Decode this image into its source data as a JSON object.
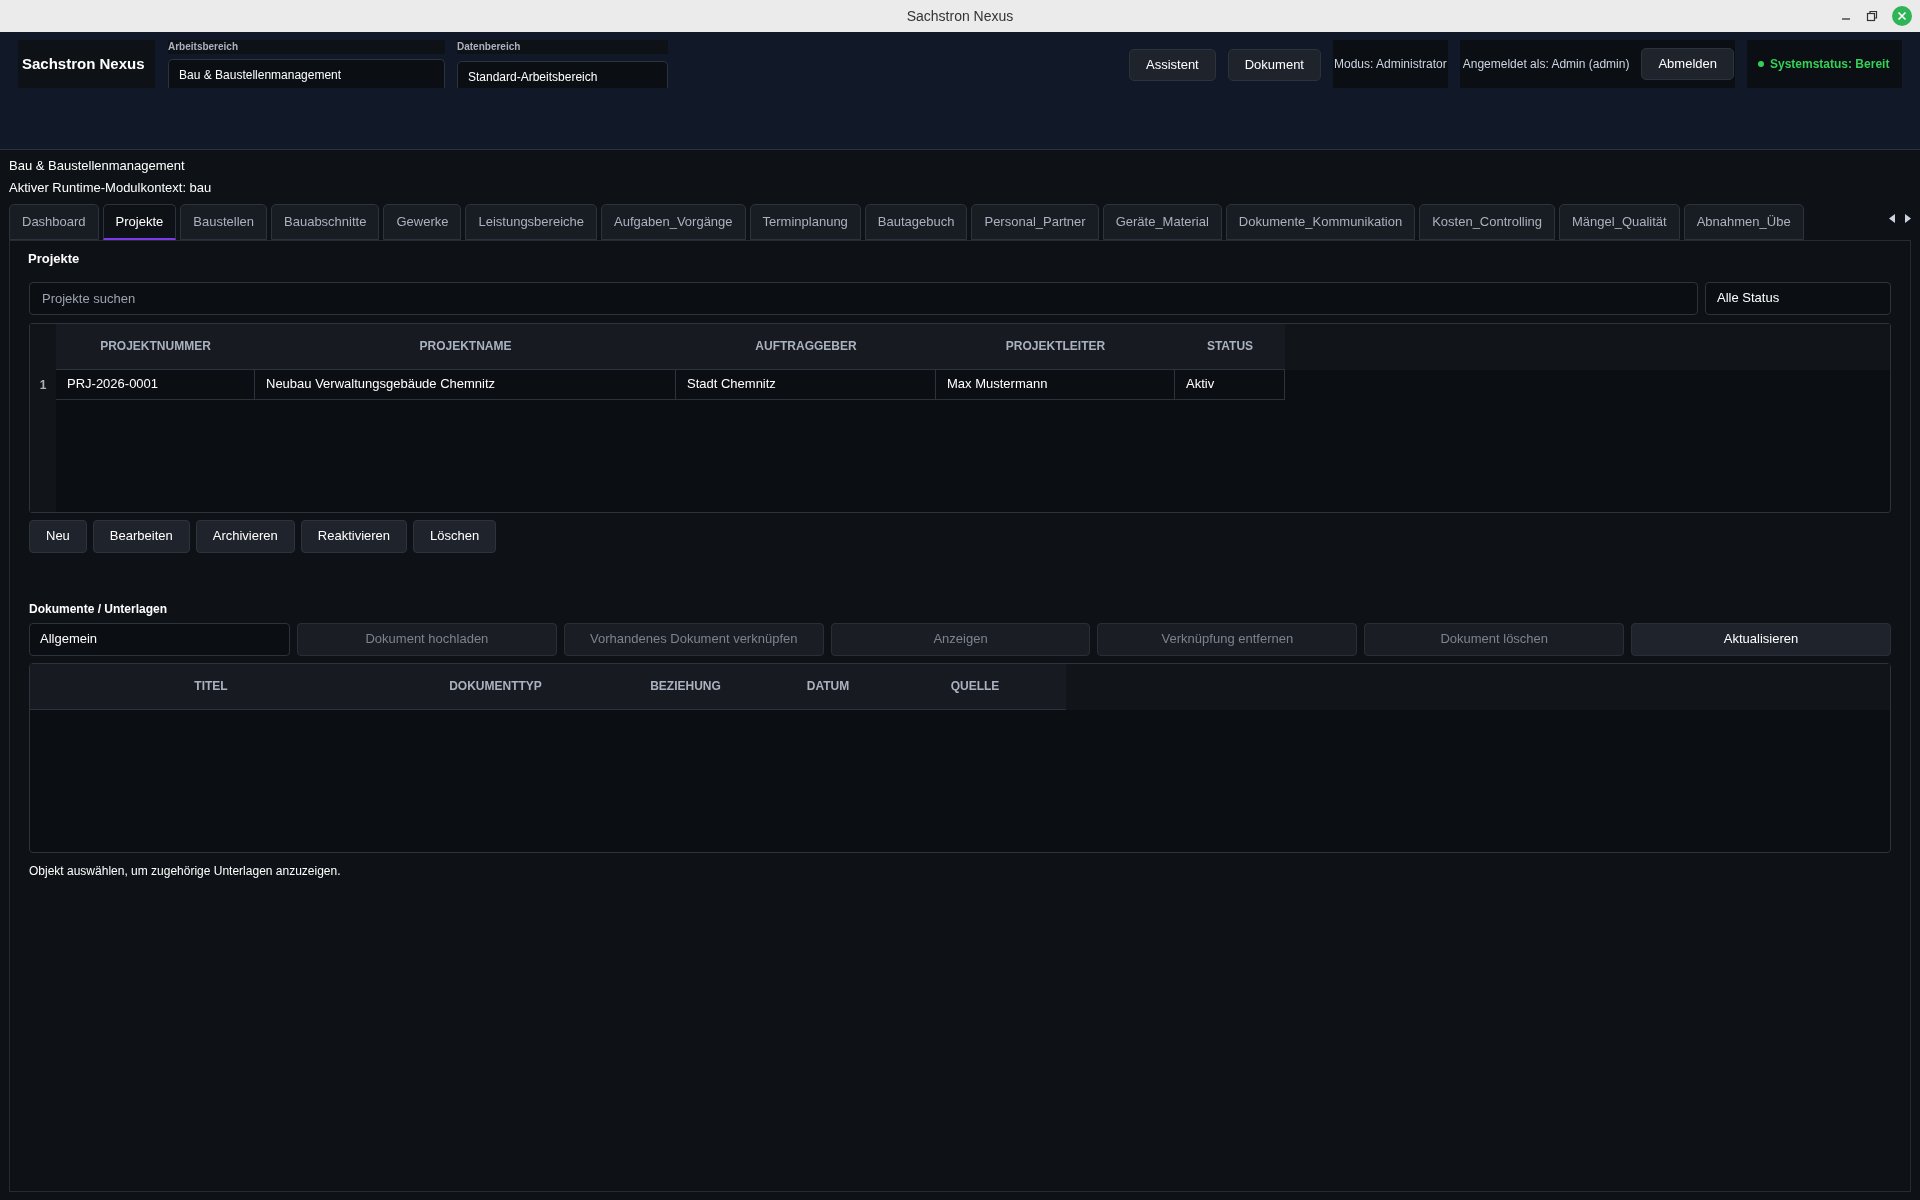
{
  "window": {
    "title": "Sachstron Nexus"
  },
  "header": {
    "brand": "Sachstron Nexus",
    "selectors": [
      {
        "label": "Arbeitsbereich",
        "value": "Bau & Baustellenmanagement"
      },
      {
        "label": "Datenbereich",
        "value": "Standard-Arbeitsbereich"
      }
    ],
    "buttons": [
      "Assistent",
      "Dokument"
    ],
    "mode": "Modus: Administrator",
    "user": "Angemeldet als: Admin (admin)",
    "logout": "Abmelden",
    "status": "Systemstatus: Bereit"
  },
  "context": [
    "Bau & Baustellenmanagement",
    "Aktiver Runtime-Modulkontext: bau"
  ],
  "tabs": [
    {
      "label": "Dashboard",
      "selected": false
    },
    {
      "label": "Projekte",
      "selected": true
    },
    {
      "label": "Baustellen",
      "selected": false
    },
    {
      "label": "Bauabschnitte",
      "selected": false
    },
    {
      "label": "Gewerke",
      "selected": false
    },
    {
      "label": "Leistungsbereiche",
      "selected": false
    },
    {
      "label": "Aufgaben_Vorgänge",
      "selected": false
    },
    {
      "label": "Terminplanung",
      "selected": false
    },
    {
      "label": "Bautagebuch",
      "selected": false
    },
    {
      "label": "Personal_Partner",
      "selected": false
    },
    {
      "label": "Geräte_Material",
      "selected": false
    },
    {
      "label": "Dokumente_Kommunikation",
      "selected": false
    },
    {
      "label": "Kosten_Controlling",
      "selected": false
    },
    {
      "label": "Mängel_Qualität",
      "selected": false
    },
    {
      "label": "Abnahmen_Übe",
      "selected": false
    }
  ],
  "projects": {
    "title": "Projekte",
    "search": {
      "placeholder": "Projekte suchen"
    },
    "status_filter": "Alle Status",
    "columns": [
      "PROJEKTNUMMER",
      "PROJEKTNAME",
      "AUFTRAGGEBER",
      "PROJEKTLEITER",
      "STATUS"
    ],
    "rows": [
      {
        "number": "1",
        "cells": [
          "PRJ-2026-0001",
          "Neubau Verwaltungsgebäude Chemnitz",
          "Stadt Chemnitz",
          "Max Mustermann",
          "Aktiv"
        ]
      }
    ],
    "buttons": [
      "Neu",
      "Bearbeiten",
      "Archivieren",
      "Reaktivieren",
      "Löschen"
    ]
  },
  "documents": {
    "title": "Dokumente / Unterlagen",
    "category": "Allgemein",
    "buttons": [
      {
        "label": "Dokument hochladen",
        "disabled": true
      },
      {
        "label": "Vorhandenes Dokument verknüpfen",
        "disabled": true
      },
      {
        "label": "Anzeigen",
        "disabled": true
      },
      {
        "label": "Verknüpfung entfernen",
        "disabled": true
      },
      {
        "label": "Dokument löschen",
        "disabled": true
      },
      {
        "label": "Aktualisieren",
        "disabled": false
      }
    ],
    "columns": [
      "TITEL",
      "DOKUMENTTYP",
      "BEZIEHUNG",
      "DATUM",
      "QUELLE"
    ],
    "hint": "Objekt auswählen, um zugehörige Unterlagen anzuzeigen."
  }
}
